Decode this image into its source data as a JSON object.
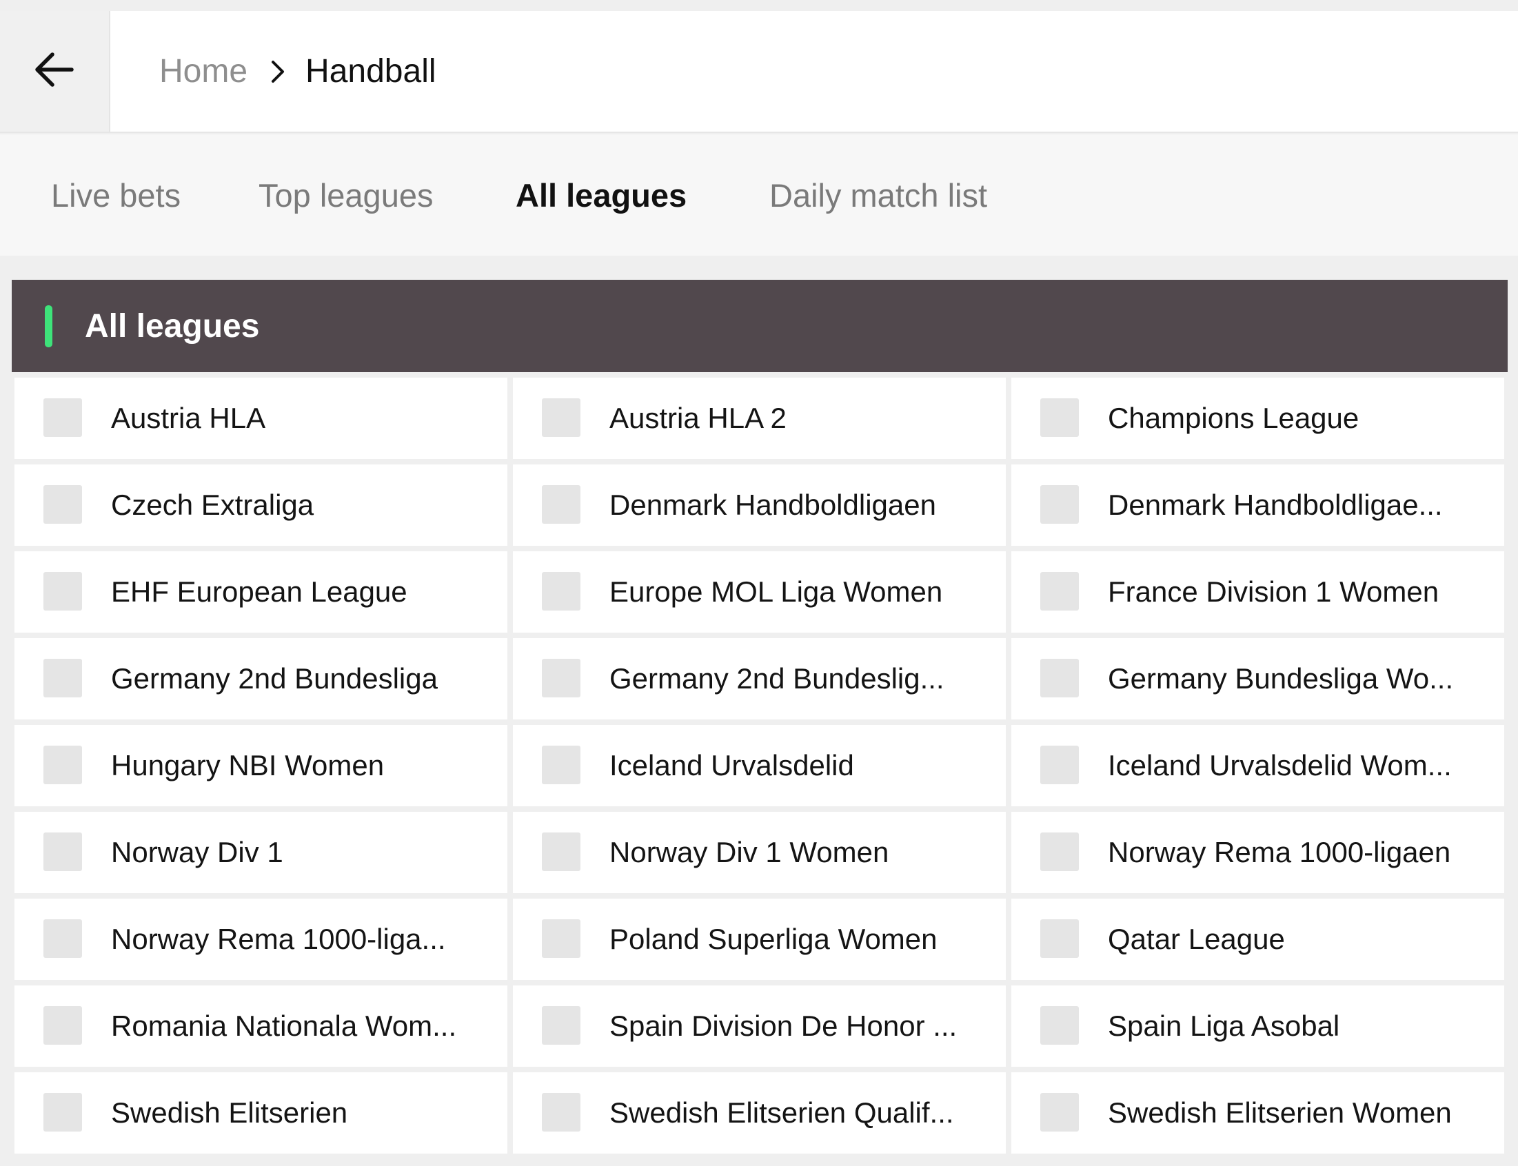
{
  "breadcrumb": {
    "home": "Home",
    "current": "Handball"
  },
  "tabs": [
    {
      "label": "Live bets",
      "active": false
    },
    {
      "label": "Top leagues",
      "active": false
    },
    {
      "label": "All leagues",
      "active": true
    },
    {
      "label": "Daily match list",
      "active": false
    }
  ],
  "section": {
    "title": "All leagues",
    "accent_color": "#3ee37a",
    "header_color": "#51484d"
  },
  "leagues": [
    "Austria HLA",
    "Austria HLA 2",
    "Champions League",
    "Czech Extraliga",
    "Denmark Handboldligaen",
    "Denmark Handboldligae...",
    "EHF European League",
    "Europe MOL Liga Women",
    "France Division 1 Women",
    "Germany 2nd Bundesliga",
    "Germany 2nd Bundeslig...",
    "Germany Bundesliga Wo...",
    "Hungary NBI Women",
    "Iceland Urvalsdelid",
    "Iceland Urvalsdelid Wom...",
    "Norway Div 1",
    "Norway Div 1 Women",
    "Norway Rema 1000-ligaen",
    "Norway Rema 1000-liga...",
    "Poland Superliga Women",
    "Qatar League",
    "Romania Nationala Wom...",
    "Spain Division De Honor ...",
    "Spain Liga Asobal",
    "Swedish Elitserien",
    "Swedish Elitserien Qualif...",
    "Swedish Elitserien Women"
  ]
}
